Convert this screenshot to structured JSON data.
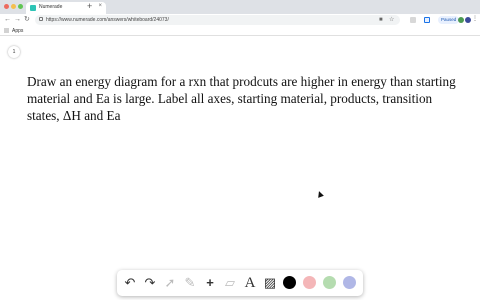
{
  "browser": {
    "tab": {
      "title": "Numerade",
      "close": "×"
    },
    "new_tab": "+",
    "url": "https://www.numerade.com/answers/whiteboard/24073/",
    "profile_status": "Paused",
    "bookmarks": {
      "apps_label": "Apps"
    },
    "nav": {
      "back": "←",
      "forward": "→",
      "reload": "↻"
    },
    "omnibox_icons": {
      "camera": "■",
      "star": "☆"
    },
    "menu": "⋮"
  },
  "colors": {
    "favicon": "#2ec4b6",
    "traffic_close": "#ed6a5e",
    "traffic_min": "#f5bf4f",
    "traffic_max": "#61c554",
    "avatar_a": "#4c9a52",
    "avatar_b": "#3b4a9a",
    "swatches": [
      "#000000",
      "#f4b6b8",
      "#b5dcb0",
      "#b0b7e6"
    ]
  },
  "page": {
    "page_number": "1",
    "question": "Draw an energy diagram for a rxn that prodcuts are higher in energy than starting material and Ea is large. Label all axes, starting material, products, transition states, ΔH and Ea"
  },
  "whiteboard_toolbar": {
    "undo": "↶",
    "redo": "↷",
    "select": "➚",
    "pen": "✎",
    "add": "+",
    "eraser": "▱",
    "text": "A",
    "image": "▨"
  }
}
